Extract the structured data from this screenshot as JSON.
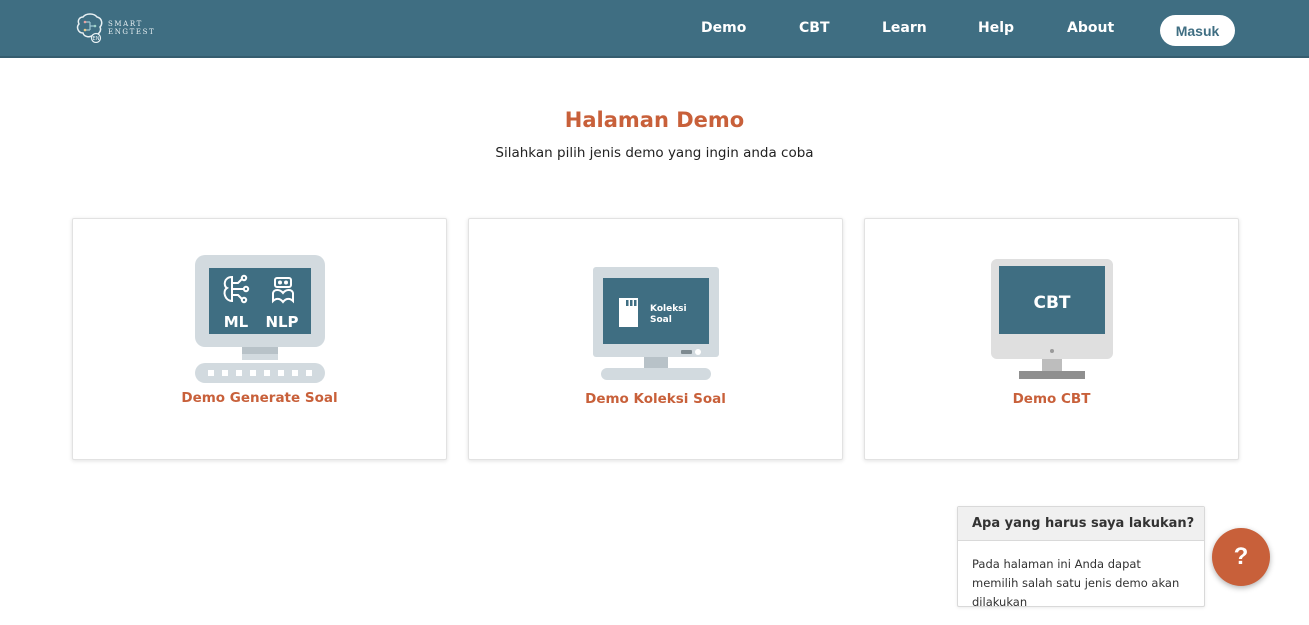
{
  "brand": {
    "line1": "SMART",
    "line2": "ENGTEST"
  },
  "nav": {
    "items": [
      "Demo",
      "CBT",
      "Learn",
      "Help",
      "About"
    ],
    "login_label": "Masuk"
  },
  "page": {
    "title": "Halaman Demo",
    "subtitle": "Silahkan pilih jenis demo yang ingin anda coba"
  },
  "cards": [
    {
      "label": "Demo Generate Soal",
      "screen_text_1": "ML",
      "screen_text_2": "NLP",
      "icon": "ml-nlp-computer-icon"
    },
    {
      "label": "Demo Koleksi Soal",
      "screen_text_1": "Koleksi",
      "screen_text_2": "Soal",
      "icon": "koleksi-soal-monitor-icon"
    },
    {
      "label": "Demo CBT",
      "screen_text_1": "CBT",
      "icon": "cbt-monitor-icon"
    }
  ],
  "help": {
    "title": "Apa yang harus saya lakukan?",
    "body": "Pada halaman ini Anda dapat memilih salah satu jenis demo akan dilakukan",
    "button": "?"
  },
  "colors": {
    "navbar": "#3f6e82",
    "accent": "#c8603a",
    "screen": "#3f6e82",
    "device_gray": "#d2dadf"
  }
}
